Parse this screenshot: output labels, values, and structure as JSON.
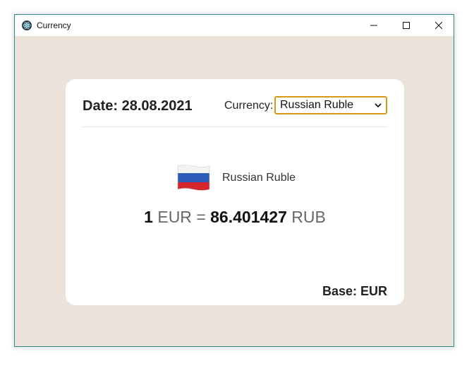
{
  "window": {
    "title": "Currency",
    "icon": "electron-atom-icon"
  },
  "header": {
    "date_text": "Date: 28.08.2021",
    "currency_label": "Currency:",
    "currency_selected": "Russian Ruble"
  },
  "conversion": {
    "flag_icon": "russia-flag-icon",
    "currency_name": "Russian Ruble",
    "amount": "1",
    "base_code": "EUR",
    "equals": "=",
    "rate": "86.401427",
    "target_code": "RUB"
  },
  "footer": {
    "base_text": "Base: EUR"
  },
  "colors": {
    "window_background": "#ebe3da",
    "select_border": "#d99a1a",
    "window_border": "#2e8b83"
  }
}
